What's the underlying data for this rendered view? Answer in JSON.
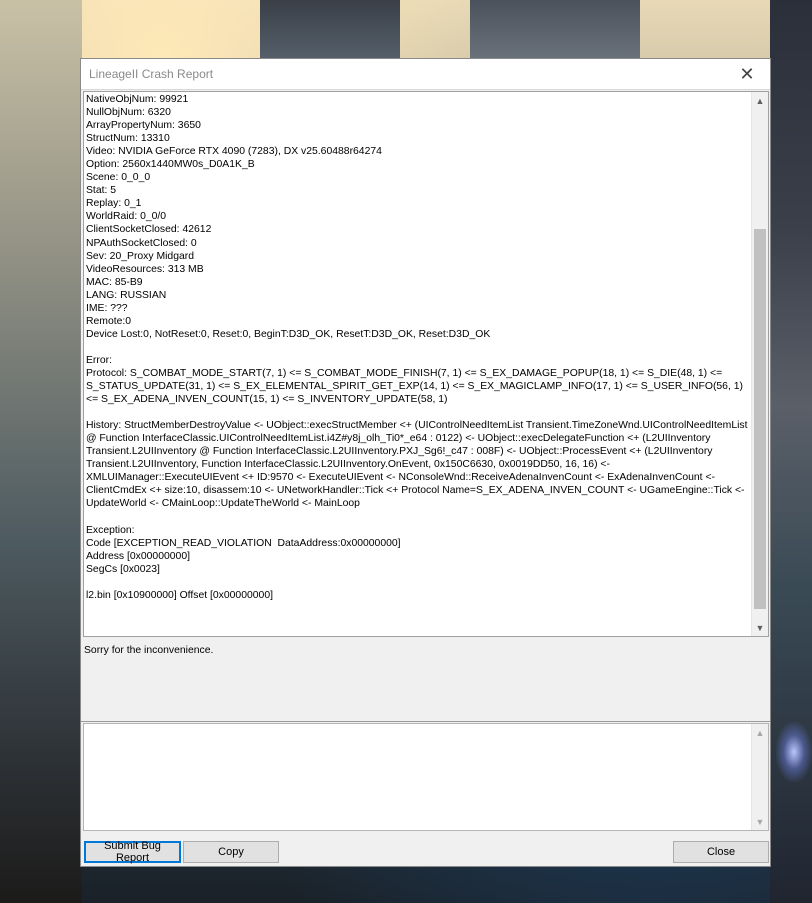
{
  "window": {
    "title": "LineageII Crash Report",
    "close_glyph": "✕"
  },
  "log": {
    "lines": [
      "NativeObjNum: 99921",
      "NullObjNum: 6320",
      "ArrayPropertyNum: 3650",
      "StructNum: 13310",
      "Video: NVIDIA GeForce RTX 4090 (7283), DX v25.60488r64274",
      "Option: 2560x1440MW0s_D0A1K_B",
      "Scene: 0_0_0",
      "Stat: 5",
      "Replay: 0_1",
      "WorldRaid: 0_0/0",
      "ClientSocketClosed: 42612",
      "NPAuthSocketClosed: 0",
      "Sev: 20_Proxy Midgard",
      "VideoResources: 313 MB",
      "MAC: 85-B9",
      "LANG: RUSSIAN",
      "IME: ???",
      "Remote:0",
      "Device Lost:0, NotReset:0, Reset:0, BeginT:D3D_OK, ResetT:D3D_OK, Reset:D3D_OK",
      "",
      "Error:",
      "Protocol: S_COMBAT_MODE_START(7, 1) <= S_COMBAT_MODE_FINISH(7, 1) <= S_EX_DAMAGE_POPUP(18, 1) <= S_DIE(48, 1) <= S_STATUS_UPDATE(31, 1) <= S_EX_ELEMENTAL_SPIRIT_GET_EXP(14, 1) <= S_EX_MAGICLAMP_INFO(17, 1) <= S_USER_INFO(56, 1) <= S_EX_ADENA_INVEN_COUNT(15, 1) <= S_INVENTORY_UPDATE(58, 1)",
      "",
      "History: StructMemberDestroyValue <- UObject::execStructMember <+ (UIControlNeedItemList Transient.TimeZoneWnd.UIControlNeedItemList @ Function InterfaceClassic.UIControlNeedItemList.i4Z#y8j_olh_Ti0*_e64 : 0122) <- UObject::execDelegateFunction <+ (L2UIInventory Transient.L2UIInventory @ Function InterfaceClassic.L2UIInventory.PXJ_Sg6!_c47 : 008F) <- UObject::ProcessEvent <+ (L2UIInventory Transient.L2UIInventory, Function InterfaceClassic.L2UIInventory.OnEvent, 0x150C6630, 0x0019DD50, 16, 16) <- XMLUIManager::ExecuteUIEvent <+ ID:9570 <- ExecuteUIEvent <- NConsoleWnd::ReceiveAdenaInvenCount <- ExAdenaInvenCount <- ClientCmdEx <+ size:10, disassem:10 <- UNetworkHandler::Tick <+ Protocol Name=S_EX_ADENA_INVEN_COUNT <- UGameEngine::Tick <- UpdateWorld <- CMainLoop::UpdateTheWorld <- MainLoop",
      "",
      "Exception:",
      "Code [EXCEPTION_READ_VIOLATION  DataAddress:0x00000000]",
      "Address [0x00000000]",
      "SegCs [0x0023]",
      "",
      "l2.bin [0x10900000] Offset [0x00000000]"
    ]
  },
  "message": "Sorry for the inconvenience.",
  "comment": {
    "value": "",
    "placeholder": ""
  },
  "scroll": {
    "up_glyph": "▲",
    "down_glyph": "▼"
  },
  "buttons": {
    "submit_label": "Submit Bug Report",
    "copy_label": "Copy",
    "close_label": "Close"
  }
}
